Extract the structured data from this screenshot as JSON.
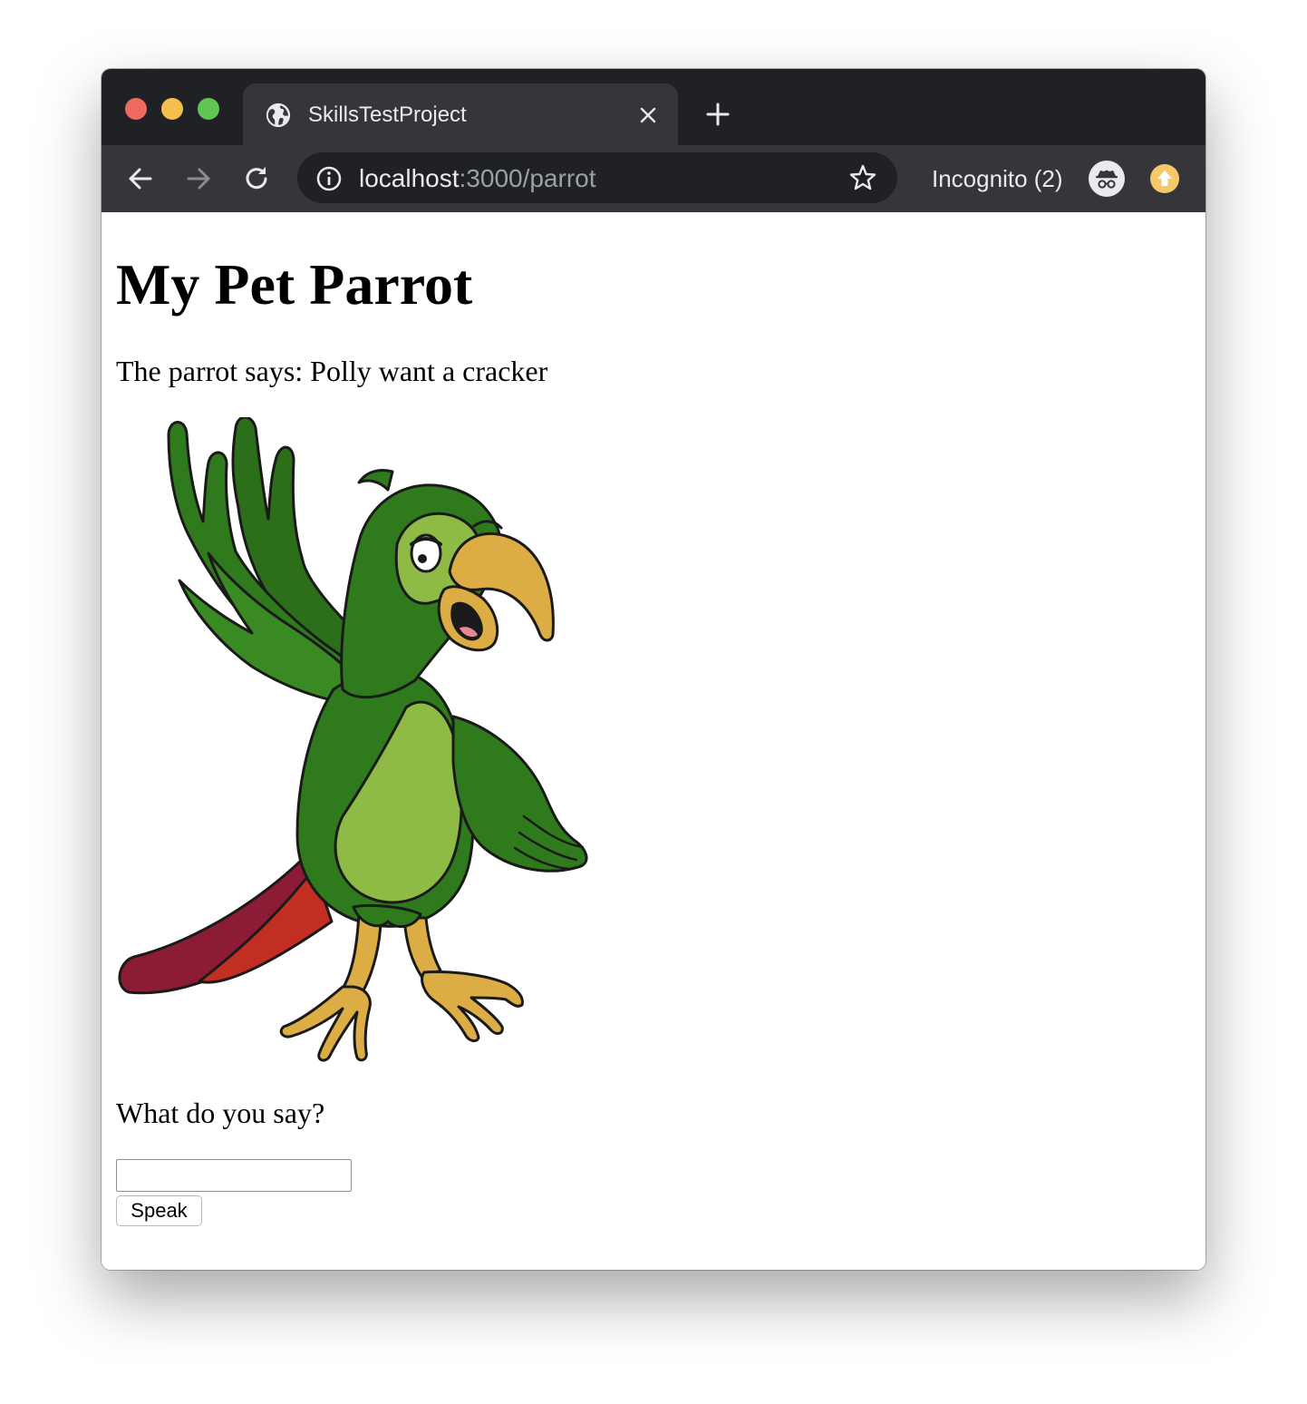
{
  "browser": {
    "tab_title": "SkillsTestProject",
    "url_host": "localhost",
    "url_rest": ":3000/parrot",
    "incognito_label": "Incognito (2)",
    "icons": [
      "globe-icon",
      "close-icon",
      "plus-icon",
      "back-arrow-icon",
      "forward-arrow-icon",
      "reload-icon",
      "info-icon",
      "star-icon",
      "incognito-icon",
      "update-icon"
    ],
    "colors": {
      "tabstrip": "#202124",
      "toolbar": "#35363a",
      "update_badge": "#f5c96a"
    }
  },
  "page": {
    "title": "My Pet Parrot",
    "parrot_says": "The parrot says: Polly want a cracker",
    "prompt": "What do you say?",
    "input_value": "",
    "button_label": "Speak",
    "image": "parrot-illustration"
  }
}
